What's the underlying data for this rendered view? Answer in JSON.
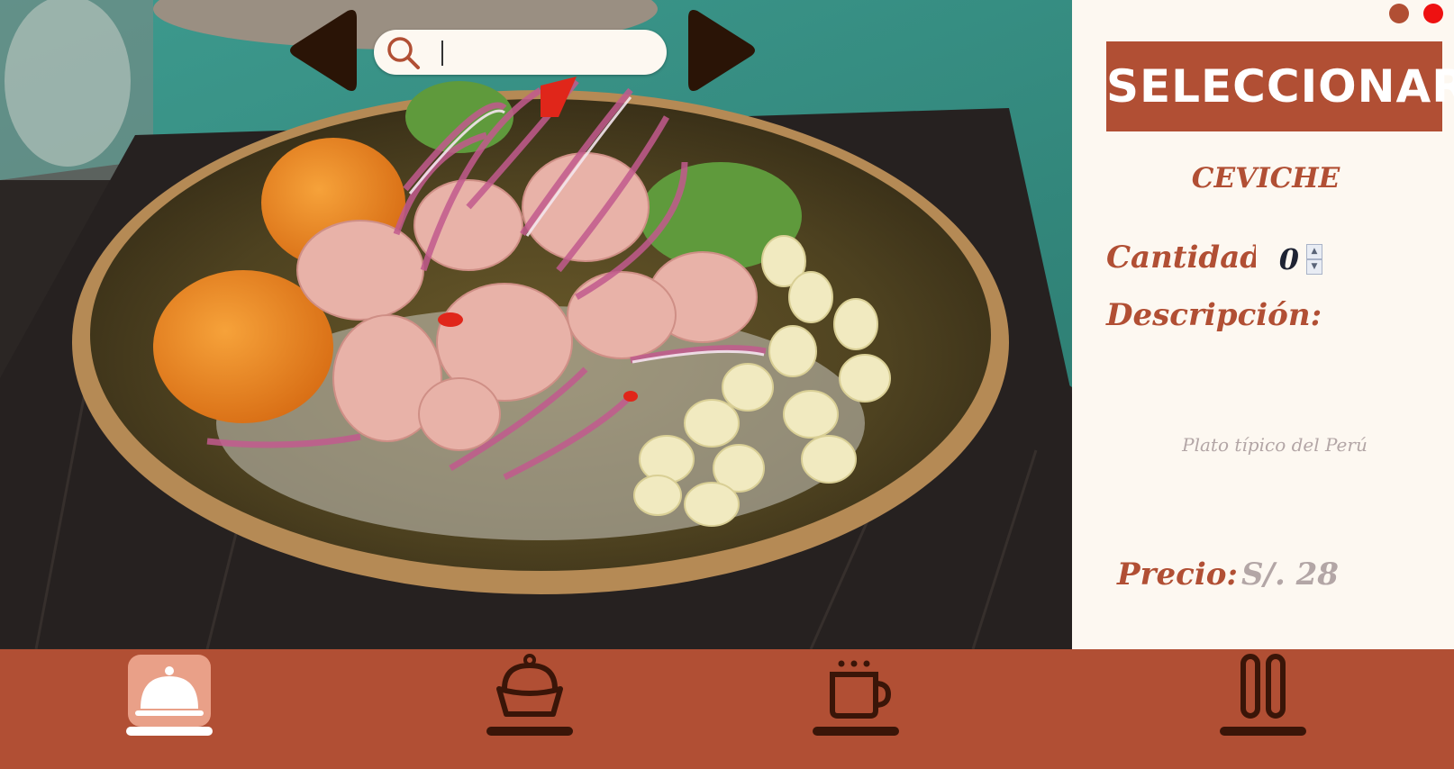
{
  "search": {
    "placeholder": "",
    "value": ""
  },
  "sidebar": {
    "select_label": "SELECCIONAR",
    "dish_name": "CEVICHE",
    "quantity_label": "Cantidad:",
    "quantity_value": "0",
    "description_label": "Descripción:",
    "description_text": "Plato típico del Perú",
    "price_label": "Precio:",
    "price_value": "S/. 28"
  },
  "bottom_nav": {
    "items": [
      {
        "icon": "cloche-icon",
        "active": true
      },
      {
        "icon": "cupcake-icon",
        "active": false
      },
      {
        "icon": "coffee-cup-icon",
        "active": false
      },
      {
        "icon": "drinks-icon",
        "active": false
      }
    ]
  },
  "colors": {
    "accent": "#b14f34",
    "icon_dark": "#3a1508",
    "background": "#fdf8f1",
    "muted_text": "#b3a6a6",
    "close_dot": "#ee1111"
  }
}
